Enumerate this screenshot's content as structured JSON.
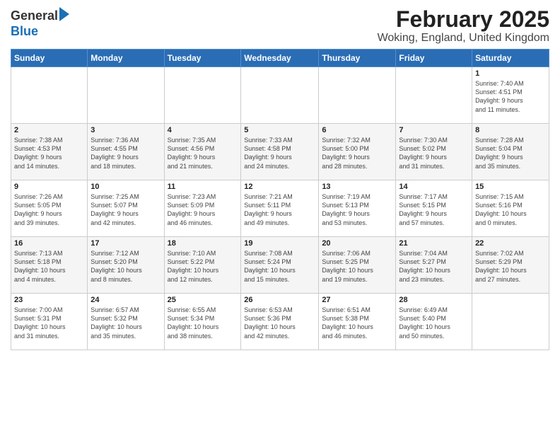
{
  "header": {
    "logo_general": "General",
    "logo_blue": "Blue",
    "title": "February 2025",
    "subtitle": "Woking, England, United Kingdom"
  },
  "days_of_week": [
    "Sunday",
    "Monday",
    "Tuesday",
    "Wednesday",
    "Thursday",
    "Friday",
    "Saturday"
  ],
  "weeks": [
    [
      {
        "day": "",
        "info": ""
      },
      {
        "day": "",
        "info": ""
      },
      {
        "day": "",
        "info": ""
      },
      {
        "day": "",
        "info": ""
      },
      {
        "day": "",
        "info": ""
      },
      {
        "day": "",
        "info": ""
      },
      {
        "day": "1",
        "info": "Sunrise: 7:40 AM\nSunset: 4:51 PM\nDaylight: 9 hours\nand 11 minutes."
      }
    ],
    [
      {
        "day": "2",
        "info": "Sunrise: 7:38 AM\nSunset: 4:53 PM\nDaylight: 9 hours\nand 14 minutes."
      },
      {
        "day": "3",
        "info": "Sunrise: 7:36 AM\nSunset: 4:55 PM\nDaylight: 9 hours\nand 18 minutes."
      },
      {
        "day": "4",
        "info": "Sunrise: 7:35 AM\nSunset: 4:56 PM\nDaylight: 9 hours\nand 21 minutes."
      },
      {
        "day": "5",
        "info": "Sunrise: 7:33 AM\nSunset: 4:58 PM\nDaylight: 9 hours\nand 24 minutes."
      },
      {
        "day": "6",
        "info": "Sunrise: 7:32 AM\nSunset: 5:00 PM\nDaylight: 9 hours\nand 28 minutes."
      },
      {
        "day": "7",
        "info": "Sunrise: 7:30 AM\nSunset: 5:02 PM\nDaylight: 9 hours\nand 31 minutes."
      },
      {
        "day": "8",
        "info": "Sunrise: 7:28 AM\nSunset: 5:04 PM\nDaylight: 9 hours\nand 35 minutes."
      }
    ],
    [
      {
        "day": "9",
        "info": "Sunrise: 7:26 AM\nSunset: 5:05 PM\nDaylight: 9 hours\nand 39 minutes."
      },
      {
        "day": "10",
        "info": "Sunrise: 7:25 AM\nSunset: 5:07 PM\nDaylight: 9 hours\nand 42 minutes."
      },
      {
        "day": "11",
        "info": "Sunrise: 7:23 AM\nSunset: 5:09 PM\nDaylight: 9 hours\nand 46 minutes."
      },
      {
        "day": "12",
        "info": "Sunrise: 7:21 AM\nSunset: 5:11 PM\nDaylight: 9 hours\nand 49 minutes."
      },
      {
        "day": "13",
        "info": "Sunrise: 7:19 AM\nSunset: 5:13 PM\nDaylight: 9 hours\nand 53 minutes."
      },
      {
        "day": "14",
        "info": "Sunrise: 7:17 AM\nSunset: 5:15 PM\nDaylight: 9 hours\nand 57 minutes."
      },
      {
        "day": "15",
        "info": "Sunrise: 7:15 AM\nSunset: 5:16 PM\nDaylight: 10 hours\nand 0 minutes."
      }
    ],
    [
      {
        "day": "16",
        "info": "Sunrise: 7:13 AM\nSunset: 5:18 PM\nDaylight: 10 hours\nand 4 minutes."
      },
      {
        "day": "17",
        "info": "Sunrise: 7:12 AM\nSunset: 5:20 PM\nDaylight: 10 hours\nand 8 minutes."
      },
      {
        "day": "18",
        "info": "Sunrise: 7:10 AM\nSunset: 5:22 PM\nDaylight: 10 hours\nand 12 minutes."
      },
      {
        "day": "19",
        "info": "Sunrise: 7:08 AM\nSunset: 5:24 PM\nDaylight: 10 hours\nand 15 minutes."
      },
      {
        "day": "20",
        "info": "Sunrise: 7:06 AM\nSunset: 5:25 PM\nDaylight: 10 hours\nand 19 minutes."
      },
      {
        "day": "21",
        "info": "Sunrise: 7:04 AM\nSunset: 5:27 PM\nDaylight: 10 hours\nand 23 minutes."
      },
      {
        "day": "22",
        "info": "Sunrise: 7:02 AM\nSunset: 5:29 PM\nDaylight: 10 hours\nand 27 minutes."
      }
    ],
    [
      {
        "day": "23",
        "info": "Sunrise: 7:00 AM\nSunset: 5:31 PM\nDaylight: 10 hours\nand 31 minutes."
      },
      {
        "day": "24",
        "info": "Sunrise: 6:57 AM\nSunset: 5:32 PM\nDaylight: 10 hours\nand 35 minutes."
      },
      {
        "day": "25",
        "info": "Sunrise: 6:55 AM\nSunset: 5:34 PM\nDaylight: 10 hours\nand 38 minutes."
      },
      {
        "day": "26",
        "info": "Sunrise: 6:53 AM\nSunset: 5:36 PM\nDaylight: 10 hours\nand 42 minutes."
      },
      {
        "day": "27",
        "info": "Sunrise: 6:51 AM\nSunset: 5:38 PM\nDaylight: 10 hours\nand 46 minutes."
      },
      {
        "day": "28",
        "info": "Sunrise: 6:49 AM\nSunset: 5:40 PM\nDaylight: 10 hours\nand 50 minutes."
      },
      {
        "day": "",
        "info": ""
      }
    ]
  ]
}
